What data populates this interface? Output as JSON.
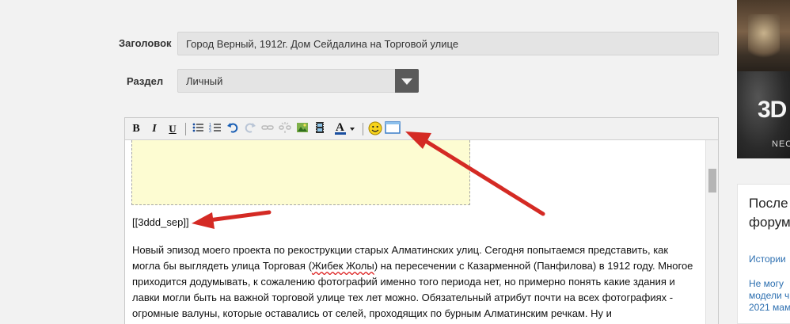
{
  "form": {
    "title_label": "Заголовок",
    "title_value": "Город Верный, 1912г. Дом Сейдалина на Торговой улице",
    "section_label": "Раздел",
    "section_value": "Личный"
  },
  "toolbar": {
    "bold": "B",
    "italic": "I",
    "underline": "U",
    "font_color": "A"
  },
  "editor": {
    "separator_tag": "[[3ddd_sep]]",
    "paragraph_before": "Новый эпизод моего проекта по рекострукции старых Алматинских улиц. Сегодня попытаемся представить, как могла бы выглядеть улица Торговая (",
    "paragraph_wavy": "Жибек Жолы",
    "paragraph_after": ") на пересечении с Казарменной (Панфилова) в 1912 году. Многое приходится додумывать, к сожалению фотографий именно того периода нет, но примерно понять какие здания и лавки могли быть на важной торговой улице тех лет можно. Обязательный атрибут почти на всех фотографиях - огромные валуны, которые оставались от селей, проходящих по бурным Алматинским речкам. Ну и"
  },
  "sidebar": {
    "promo_big": "3D",
    "promo_small": "NEC",
    "card_title_1": "После",
    "card_title_2": "форум",
    "links": [
      "Истории",
      "Не могу",
      "модели ч",
      "2021 мам"
    ]
  },
  "colors": {
    "arrow": "#d42a24",
    "link": "#2d6fb0",
    "highlight_box": "#fdfcd2"
  }
}
